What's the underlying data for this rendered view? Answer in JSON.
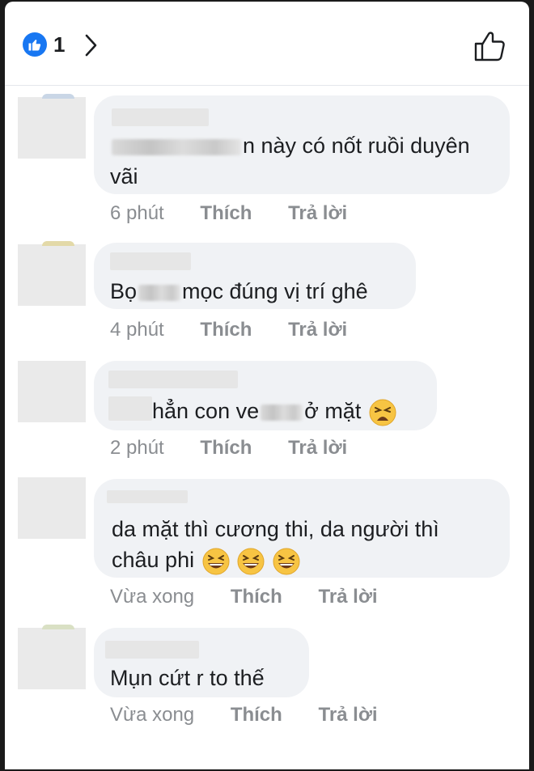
{
  "header": {
    "like_count": "1"
  },
  "comments": [
    {
      "text_before": "",
      "text_after": "n này có nốt ruồi duyên",
      "text_line2": "vãi",
      "time": "6 phút",
      "like_label": "Thích",
      "reply_label": "Trả lời"
    },
    {
      "text_before": "Bọ",
      "text_after": "mọc đúng vị trí ghê",
      "time": "4 phút",
      "like_label": "Thích",
      "reply_label": "Trả lời"
    },
    {
      "text_before": "hẳn con ve",
      "text_after": "ở mặt",
      "emoji": "tired-face-emoji",
      "time": "2 phút",
      "like_label": "Thích",
      "reply_label": "Trả lời"
    },
    {
      "text_line1": "da mặt thì cương thi, da người thì",
      "text_line2": "châu phi",
      "emoji": "grinning-squinting-face-emoji",
      "time": "Vừa xong",
      "like_label": "Thích",
      "reply_label": "Trả lời"
    },
    {
      "text_line1": "Mụn cứt r  to thế",
      "time": "Vừa xong",
      "like_label": "Thích",
      "reply_label": "Trả lời"
    }
  ],
  "colors": {
    "accent": "#1877f2",
    "bubble": "#f0f2f5",
    "meta_text": "#8a8d91"
  }
}
